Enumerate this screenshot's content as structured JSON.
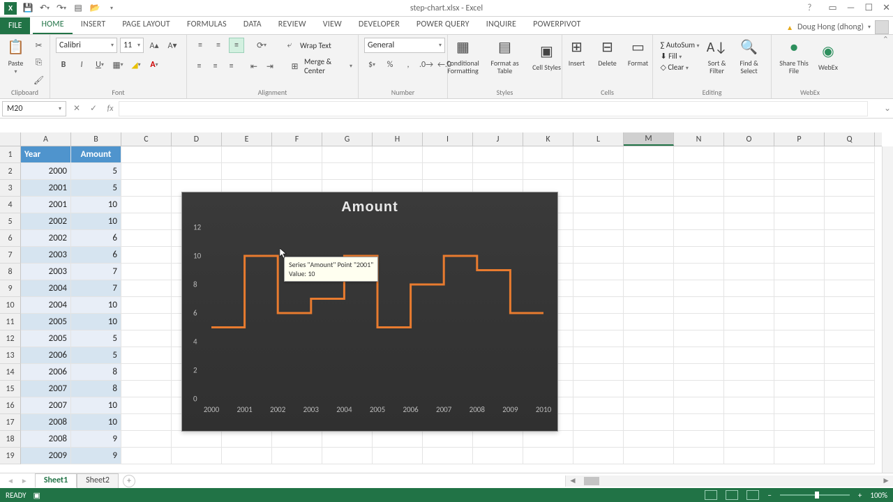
{
  "titlebar": {
    "title": "step-chart.xlsx - Excel"
  },
  "win": {
    "help": "?",
    "full": "▭",
    "min": "—",
    "max": "☐",
    "close": "✕"
  },
  "tabs": {
    "file": "FILE",
    "items": [
      "HOME",
      "INSERT",
      "PAGE LAYOUT",
      "FORMULAS",
      "DATA",
      "REVIEW",
      "VIEW",
      "DEVELOPER",
      "POWER QUERY",
      "INQUIRE",
      "POWERPIVOT"
    ],
    "active_index": 0
  },
  "user": {
    "name": "Doug Hong (dhong)"
  },
  "ribbon": {
    "clipboard": {
      "label": "Clipboard",
      "paste": "Paste"
    },
    "font": {
      "label": "Font",
      "name": "Calibri",
      "size": "11"
    },
    "alignment": {
      "label": "Alignment",
      "wrap": "Wrap Text",
      "merge": "Merge & Center"
    },
    "number": {
      "label": "Number",
      "format": "General"
    },
    "styles": {
      "label": "Styles",
      "cond": "Conditional Formatting",
      "fmt_table": "Format as Table",
      "cell_styles": "Cell Styles"
    },
    "cells": {
      "label": "Cells",
      "insert": "Insert",
      "delete": "Delete",
      "format": "Format"
    },
    "editing": {
      "label": "Editing",
      "autosum": "AutoSum",
      "fill": "Fill",
      "clear": "Clear",
      "sort": "Sort & Filter",
      "find": "Find & Select"
    },
    "share": {
      "share": "Share This File",
      "webex": "WebEx",
      "label": "WebEx"
    }
  },
  "namebox": {
    "ref": "M20"
  },
  "columns": [
    "A",
    "B",
    "C",
    "D",
    "E",
    "F",
    "G",
    "H",
    "I",
    "J",
    "K",
    "L",
    "M",
    "N",
    "O",
    "P",
    "Q"
  ],
  "selected_col_index": 12,
  "row_count": 19,
  "table": {
    "headers": [
      "Year",
      "Amount"
    ],
    "rows": [
      [
        "2000",
        "5"
      ],
      [
        "2001",
        "5"
      ],
      [
        "2001",
        "10"
      ],
      [
        "2002",
        "10"
      ],
      [
        "2002",
        "6"
      ],
      [
        "2003",
        "6"
      ],
      [
        "2003",
        "7"
      ],
      [
        "2004",
        "7"
      ],
      [
        "2004",
        "10"
      ],
      [
        "2005",
        "10"
      ],
      [
        "2005",
        "5"
      ],
      [
        "2006",
        "5"
      ],
      [
        "2006",
        "8"
      ],
      [
        "2007",
        "8"
      ],
      [
        "2007",
        "10"
      ],
      [
        "2008",
        "10"
      ],
      [
        "2008",
        "9"
      ],
      [
        "2009",
        "9"
      ]
    ]
  },
  "chart_data": {
    "type": "line",
    "title": "Amount",
    "ylabel": "",
    "xlabel": "",
    "ylim": [
      0,
      12
    ],
    "yticks": [
      0,
      2,
      4,
      6,
      8,
      10,
      12
    ],
    "categories": [
      "2000",
      "2001",
      "2002",
      "2003",
      "2004",
      "2005",
      "2006",
      "2007",
      "2008",
      "2009",
      "2010"
    ],
    "step_points": [
      {
        "x": 0,
        "y": 5
      },
      {
        "x": 1,
        "y": 5
      },
      {
        "x": 1,
        "y": 10
      },
      {
        "x": 2,
        "y": 10
      },
      {
        "x": 2,
        "y": 6
      },
      {
        "x": 3,
        "y": 6
      },
      {
        "x": 3,
        "y": 7
      },
      {
        "x": 4,
        "y": 7
      },
      {
        "x": 4,
        "y": 10
      },
      {
        "x": 5,
        "y": 10
      },
      {
        "x": 5,
        "y": 5
      },
      {
        "x": 6,
        "y": 5
      },
      {
        "x": 6,
        "y": 8
      },
      {
        "x": 7,
        "y": 8
      },
      {
        "x": 7,
        "y": 10
      },
      {
        "x": 8,
        "y": 10
      },
      {
        "x": 8,
        "y": 9
      },
      {
        "x": 9,
        "y": 9
      },
      {
        "x": 9,
        "y": 6
      },
      {
        "x": 10,
        "y": 6
      }
    ],
    "series_color": "#e87b2f",
    "tooltip": {
      "line1": "Series \"Amount\" Point \"2001\"",
      "line2": "Value: 10"
    }
  },
  "sheets": {
    "tabs": [
      "Sheet1",
      "Sheet2"
    ],
    "active_index": 0,
    "nav": [
      "◄",
      "►"
    ]
  },
  "status": {
    "ready": "READY",
    "zoom": "100%",
    "minus": "−",
    "plus": "+"
  }
}
